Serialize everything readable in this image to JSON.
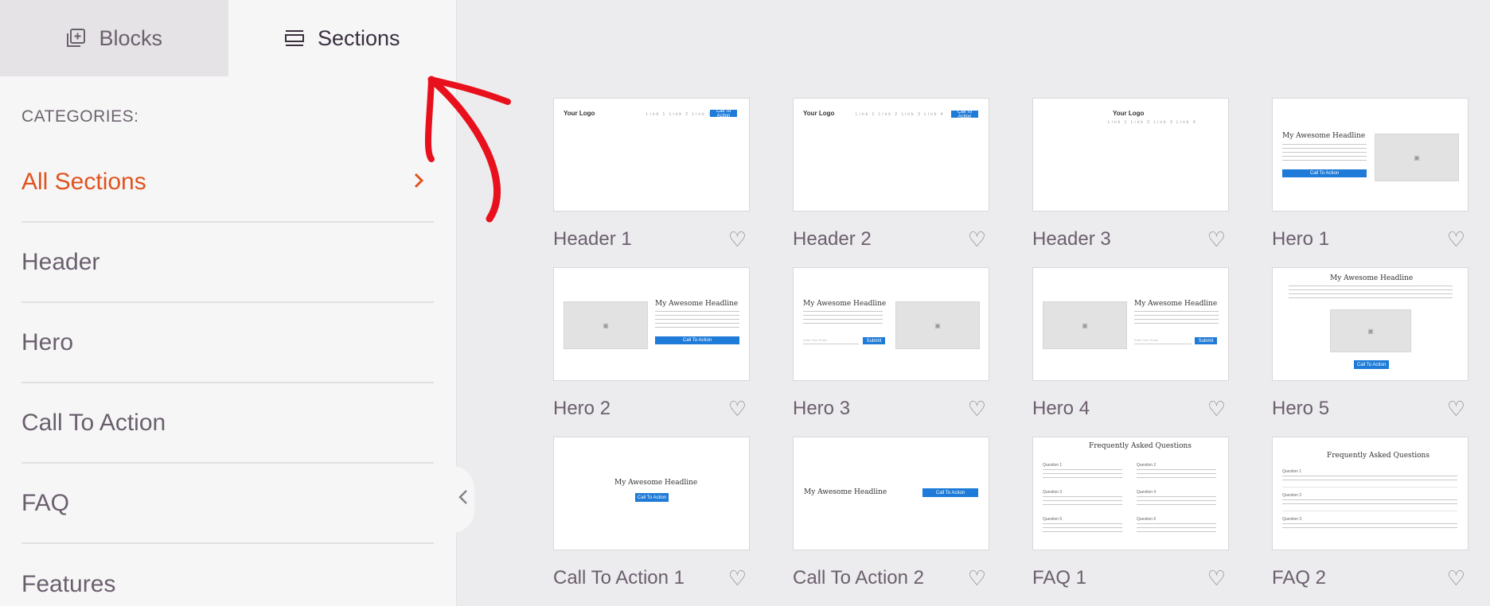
{
  "tabs": [
    {
      "label": "Blocks",
      "icon": "add-block-icon",
      "active": false
    },
    {
      "label": "Sections",
      "icon": "sections-icon",
      "active": true
    }
  ],
  "sidebar": {
    "categories_label": "CATEGORIES:",
    "items": [
      {
        "label": "All Sections",
        "active": true
      },
      {
        "label": "Header"
      },
      {
        "label": "Hero"
      },
      {
        "label": "Call To Action"
      },
      {
        "label": "FAQ"
      },
      {
        "label": "Features"
      }
    ]
  },
  "colors": {
    "accent": "#e0531f",
    "primary_button": "#1e7bd8",
    "annotation": "#e8101c"
  },
  "thumb_text": {
    "logo": "Your Logo",
    "nav": "Link 1  Link 2  Link 3  Link 4",
    "cta": "Call To Action",
    "headline": "My Awesome Headline",
    "submit": "Submit",
    "email_placeholder": "Enter Your Email",
    "faq_title": "Frequently Asked Questions",
    "q1": "Question 1",
    "q2": "Question 2",
    "q3": "Question 3",
    "q4": "Question 4",
    "q5": "Question 5",
    "q6": "Question 6"
  },
  "sections": [
    {
      "name": "Header 1"
    },
    {
      "name": "Header 2"
    },
    {
      "name": "Header 3"
    },
    {
      "name": "Hero 1"
    },
    {
      "name": "Hero 2"
    },
    {
      "name": "Hero 3"
    },
    {
      "name": "Hero 4"
    },
    {
      "name": "Hero 5"
    },
    {
      "name": "Call To Action 1"
    },
    {
      "name": "Call To Action 2"
    },
    {
      "name": "FAQ 1"
    },
    {
      "name": "FAQ 2"
    }
  ]
}
